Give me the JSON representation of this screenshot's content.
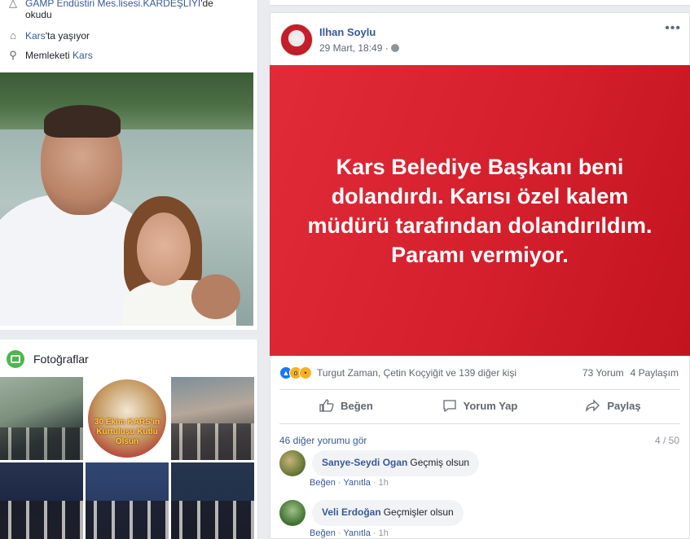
{
  "profile": {
    "education_name": "GAMP Endüstiri Mes.lisesi.KARDEŞLİYİ",
    "education_suffix": "'de",
    "education_line2": "okudu",
    "lives_city": "Kars",
    "lives_suffix": "'ta yaşıyor",
    "from_prefix": "Memleketi ",
    "from_city": "Kars"
  },
  "photos": {
    "title": "Fotoğraflar",
    "thumb2_text": "30 Ekim KARS'ın Kurtuluşu Kutlu Olsun"
  },
  "post": {
    "author": "Ilhan Soylu",
    "time": "29 Mart, 18:49 ·",
    "more": "•••",
    "banner_text": "Kars Belediye Başkanı beni dolandırdı. Karısı özel kalem müdürü tarafından dolandırıldım. Paramı vermiyor.",
    "reactions_text": "Turgut Zaman, Çetin Koçyiğit ve 139 diğer kişi",
    "comments_count": "73 Yorum",
    "shares_count": "4 Paylaşım",
    "actions": {
      "like": "Beğen",
      "comment": "Yorum Yap",
      "share": "Paylaş"
    },
    "more_comments": "46 diğer yorumu gör",
    "pager": "4 / 50",
    "comments": [
      {
        "name": "Sanye-Seydi Ogan",
        "text": "Geçmiş olsun",
        "like": "Beğen",
        "reply": "Yanıtla",
        "time": "1h"
      },
      {
        "name": "Veli Erdoğan",
        "text": "Geçmişler olsun",
        "like": "Beğen",
        "reply": "Yanıtla",
        "time": "1h"
      }
    ]
  }
}
